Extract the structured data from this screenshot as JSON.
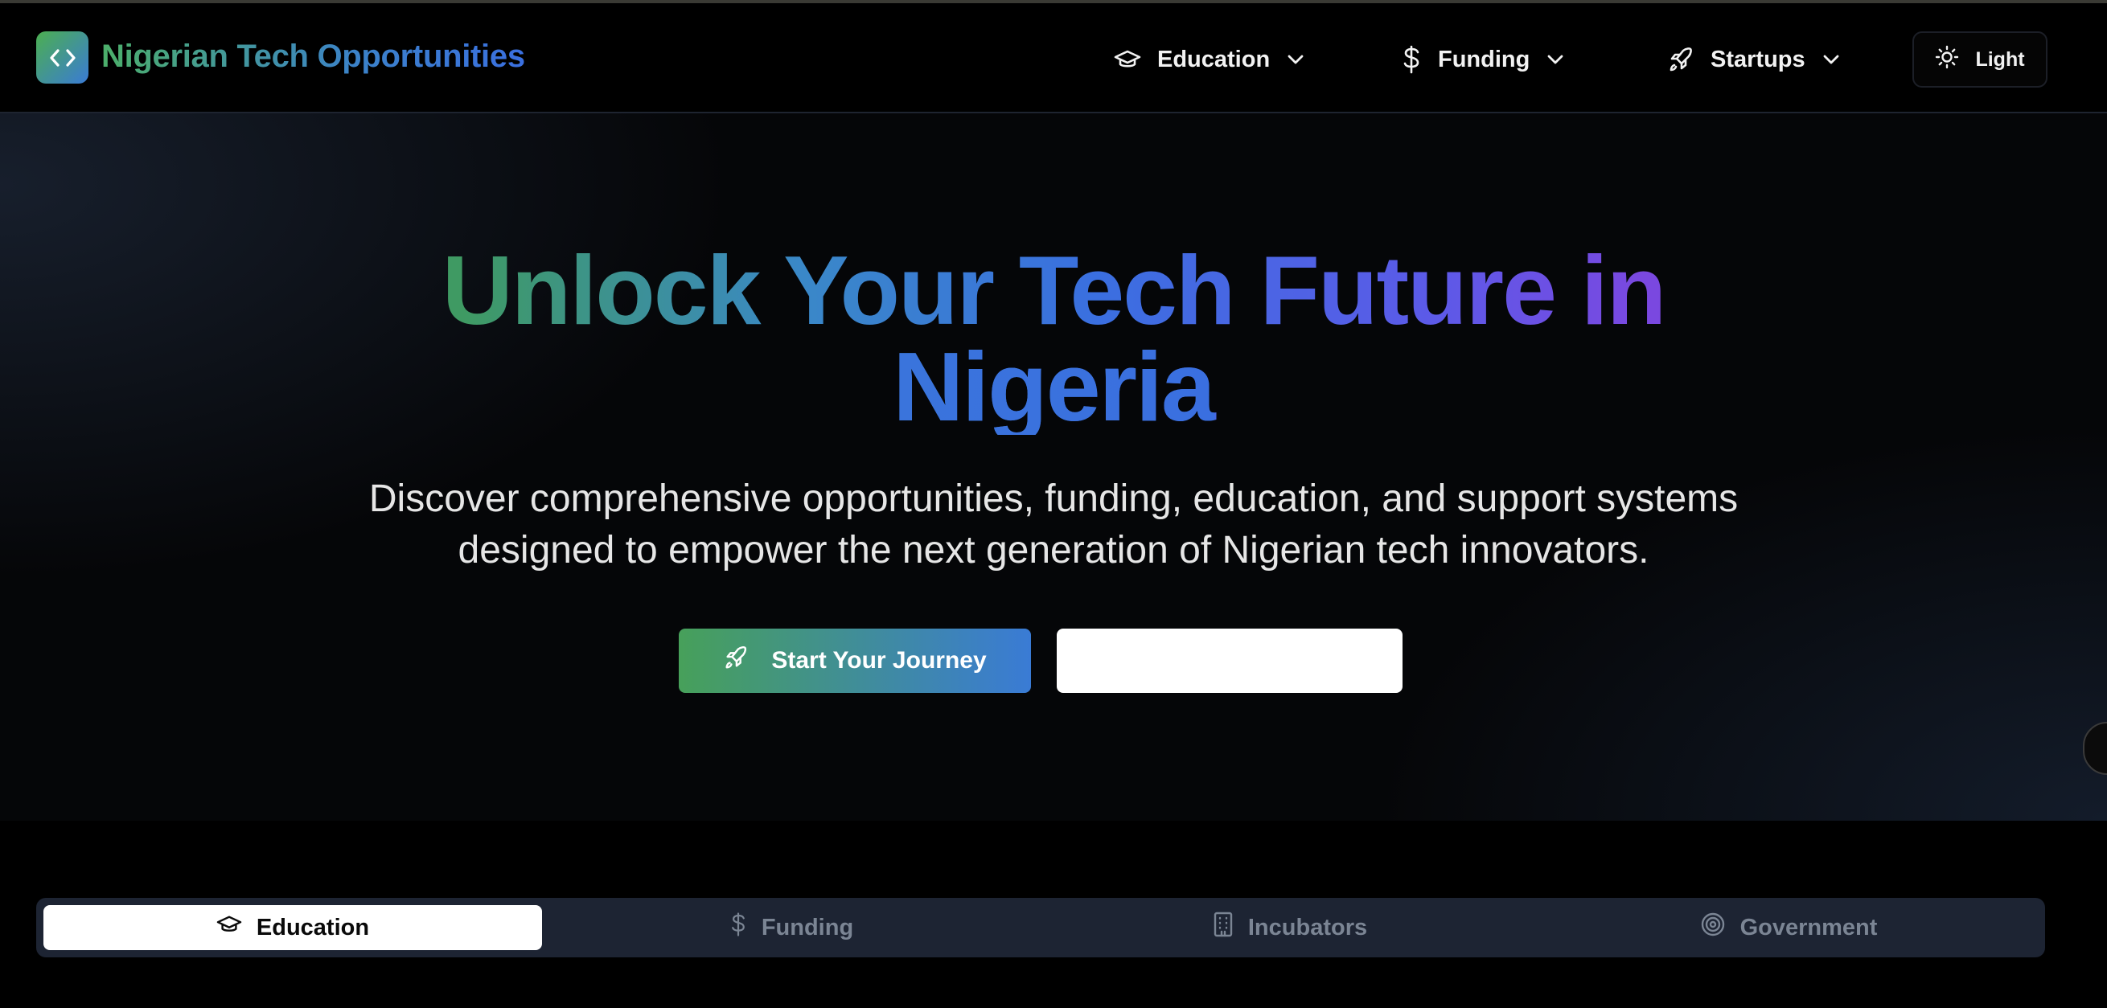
{
  "header": {
    "logo_icon": "code-brackets-icon",
    "title": "Nigerian Tech Opportunities",
    "nav": [
      {
        "label": "Education",
        "icon": "graduation-cap-icon"
      },
      {
        "label": "Funding",
        "icon": "dollar-icon"
      },
      {
        "label": "Startups",
        "icon": "rocket-icon"
      }
    ],
    "theme_toggle": {
      "label": "Light",
      "icon": "sun-icon"
    }
  },
  "hero": {
    "title_line1": "Unlock Your Tech Future in",
    "title_line2": "Nigeria",
    "subtitle": "Discover comprehensive opportunities, funding, education, and support systems designed to empower the next generation of Nigerian tech innovators.",
    "primary_button": {
      "label": "Start Your Journey",
      "icon": "rocket-icon"
    },
    "secondary_button": {
      "label": ""
    }
  },
  "tabs": [
    {
      "label": "Education",
      "icon": "graduation-cap-icon",
      "active": true
    },
    {
      "label": "Funding",
      "icon": "dollar-icon",
      "active": false
    },
    {
      "label": "Incubators",
      "icon": "building-icon",
      "active": false
    },
    {
      "label": "Government",
      "icon": "target-icon",
      "active": false
    }
  ],
  "colors": {
    "brand_green": "#4caf50",
    "brand_blue": "#3a7bd5",
    "brand_purple": "#7a48e0",
    "tab_bar_bg": "#1d2433"
  }
}
